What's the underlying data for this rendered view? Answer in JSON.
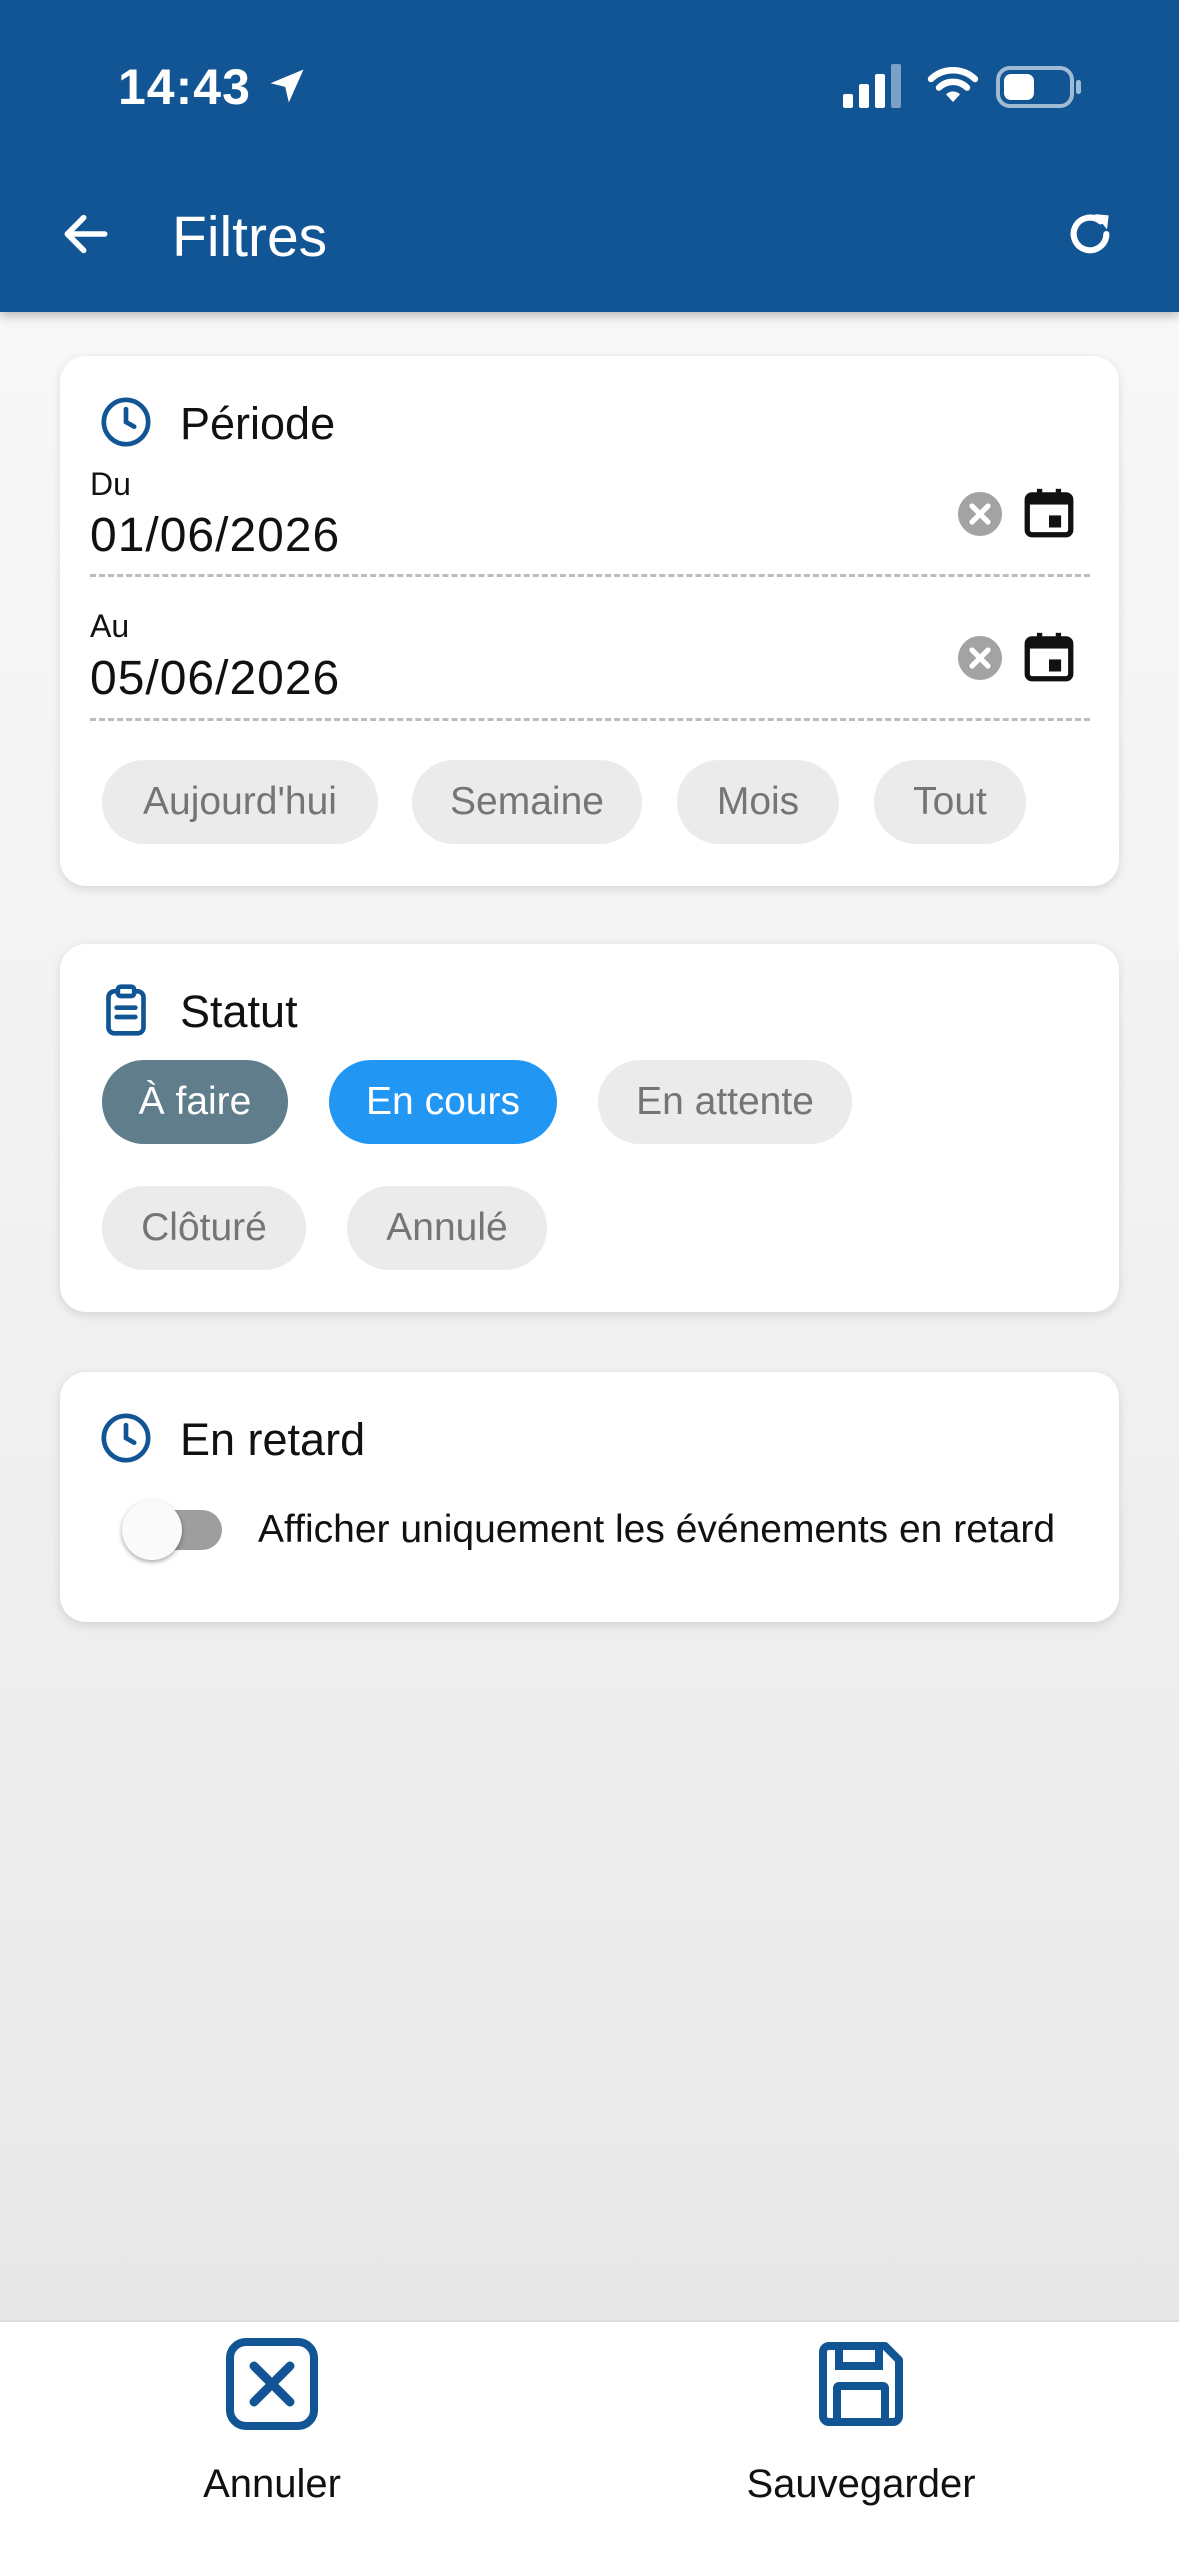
{
  "status_bar": {
    "time": "14:43",
    "icons": [
      "location-arrow-icon",
      "cellular-signal-icon",
      "wifi-icon",
      "battery-icon"
    ]
  },
  "header": {
    "title": "Filtres",
    "back_icon": "arrow-left-icon",
    "refresh_icon": "refresh-icon",
    "background": "#125594"
  },
  "period": {
    "title": "Période",
    "icon": "clock-icon",
    "from": {
      "label": "Du",
      "value": "01/06/2026"
    },
    "to": {
      "label": "Au",
      "value": "05/06/2026"
    },
    "presets": [
      "Aujourd'hui",
      "Semaine",
      "Mois",
      "Tout"
    ]
  },
  "status": {
    "title": "Statut",
    "icon": "clipboard-icon",
    "chips": [
      {
        "label": "À faire",
        "selected": true,
        "color": "#5f7d8a"
      },
      {
        "label": "En cours",
        "selected": true,
        "color": "#2196f3"
      },
      {
        "label": "En attente",
        "selected": false
      },
      {
        "label": "Clôturé",
        "selected": false
      },
      {
        "label": "Annulé",
        "selected": false
      }
    ]
  },
  "late": {
    "title": "En retard",
    "icon": "clock-icon",
    "toggle_label": "Afficher uniquement les événements en retard",
    "toggle_on": false
  },
  "bottom_bar": {
    "cancel_label": "Annuler",
    "save_label": "Sauvegarder",
    "accent": "#125594"
  }
}
